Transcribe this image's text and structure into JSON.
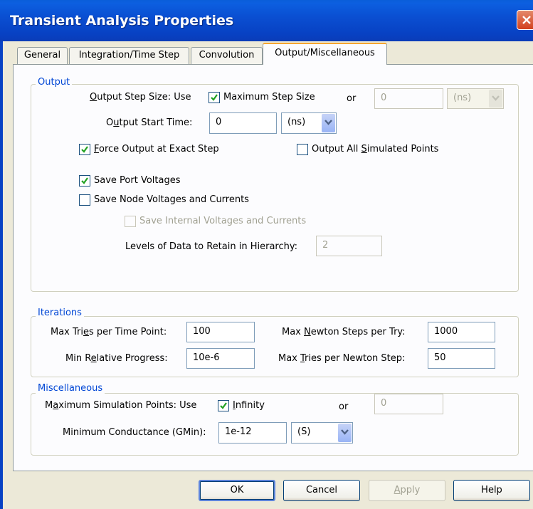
{
  "window": {
    "title": "Transient Analysis Properties"
  },
  "tabs": [
    {
      "label": "General"
    },
    {
      "label": "Integration/Time Step"
    },
    {
      "label": "Convolution"
    },
    {
      "label": "Output/Miscellaneous"
    }
  ],
  "output": {
    "legend": "Output",
    "step_size_label": "Output Step Size: Use",
    "max_step_checkbox": {
      "label": "Maximum Step Size",
      "checked": true
    },
    "or_label": "or",
    "step_value": "0",
    "step_unit": "(ns)",
    "start_time_label": "Output Start Time:",
    "start_time_value": "0",
    "start_time_unit": "(ns)",
    "force_output": {
      "label": "Force Output at Exact Step",
      "checked": true
    },
    "output_all": {
      "label": "Output All Simulated Points",
      "checked": false
    },
    "save_port": {
      "label": "Save Port Voltages",
      "checked": true
    },
    "save_node": {
      "label": "Save Node Voltages and Currents",
      "checked": false
    },
    "save_internal": {
      "label": "Save Internal Voltages and Currents",
      "checked": false
    },
    "levels_label": "Levels of Data to Retain in Hierarchy:",
    "levels_value": "2"
  },
  "iterations": {
    "legend": "Iterations",
    "max_tries_label": "Max Tries per Time Point:",
    "max_tries_value": "100",
    "min_progress_label": "Min Relative Progress:",
    "min_progress_value": "10e-6",
    "max_newton_label": "Max Newton Steps per Try:",
    "max_newton_value": "1000",
    "max_tries_newton_label": "Max Tries per Newton Step:",
    "max_tries_newton_value": "50"
  },
  "misc": {
    "legend": "Miscellaneous",
    "max_sim_label": "Maximum Simulation Points: Use",
    "infinity": {
      "label": "Infinity",
      "checked": true
    },
    "or_label": "or",
    "max_sim_value": "0",
    "gmin_label": "Minimum Conductance (GMin):",
    "gmin_value": "1e-12",
    "gmin_unit": "(S)"
  },
  "buttons": {
    "ok": "OK",
    "cancel": "Cancel",
    "apply": "Apply",
    "help": "Help"
  },
  "colors": {
    "titlebar": "#0a4fd2",
    "legend_text": "#0046d5",
    "active_tab_accent": "#f5a530"
  }
}
